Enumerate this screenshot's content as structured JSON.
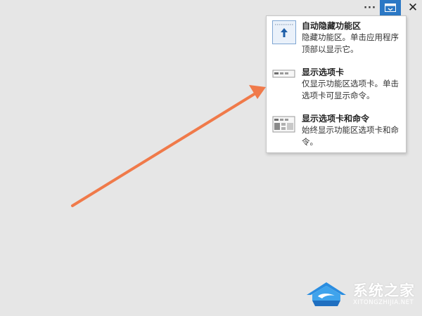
{
  "window_controls": {
    "more_glyph": "···",
    "ribbon_options_icon": "ribbon-display-options-icon",
    "close_glyph": "✕"
  },
  "menu": {
    "items": [
      {
        "title": "自动隐藏功能区",
        "description": "隐藏功能区。单击应用程序顶部以显示它。",
        "icon": "auto-hide-ribbon-icon"
      },
      {
        "title": "显示选项卡",
        "description": "仅显示功能区选项卡。单击选项卡可显示命令。",
        "icon": "show-tabs-icon"
      },
      {
        "title": "显示选项卡和命令",
        "description": "始终显示功能区选项卡和命令。",
        "icon": "show-tabs-and-commands-icon"
      }
    ]
  },
  "annotation": {
    "arrow_color": "#f07a4a"
  },
  "watermark": {
    "brand": "系统之家",
    "url": "XITONGZHIJIA.NET"
  },
  "colors": {
    "background": "#e6e6e6",
    "accent": "#2b78c5",
    "menu_bg": "#ffffff"
  }
}
